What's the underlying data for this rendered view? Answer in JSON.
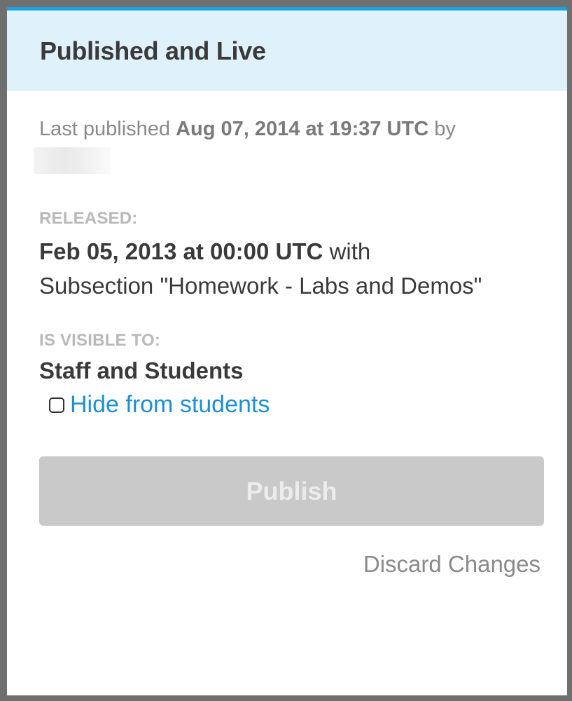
{
  "panel": {
    "title": "Published and Live",
    "last_published_prefix": "Last published ",
    "last_published_date": "Aug 07, 2014 at 19:37 UTC",
    "last_published_suffix": " by",
    "released_label": "RELEASED:",
    "released_date": "Feb 05, 2013 at 00:00 UTC",
    "released_with": " with",
    "released_subsection": "Subsection \"Homework - Labs and Demos\"",
    "visible_label": "IS VISIBLE TO:",
    "visible_value": "Staff and Students",
    "hide_link": "Hide from students",
    "hide_checked": false,
    "publish_label": "Publish",
    "discard_label": "Discard Changes"
  },
  "colors": {
    "accent": "#1aa1e2",
    "header_bg": "#dff1fa",
    "link": "#1d8fd6",
    "disabled_button": "#c9c9c9"
  }
}
